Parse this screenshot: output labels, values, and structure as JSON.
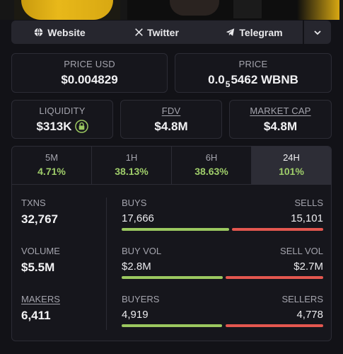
{
  "links": {
    "website": "Website",
    "twitter": "Twitter",
    "telegram": "Telegram"
  },
  "price_usd": {
    "label": "PRICE USD",
    "value": "$0.004829"
  },
  "price_native": {
    "label": "PRICE",
    "prefix": "0.0",
    "subscript": "5",
    "rest": "5462 WBNB"
  },
  "liquidity": {
    "label": "LIQUIDITY",
    "value": "$313K"
  },
  "fdv": {
    "label": "FDV",
    "value": "$4.8M"
  },
  "market_cap": {
    "label": "MARKET CAP",
    "value": "$4.8M"
  },
  "tabs": [
    {
      "label": "5M",
      "value": "4.71%"
    },
    {
      "label": "1H",
      "value": "38.13%"
    },
    {
      "label": "6H",
      "value": "38.63%"
    },
    {
      "label": "24H",
      "value": "101%"
    }
  ],
  "active_tab": "24H",
  "metrics": {
    "txns": {
      "label": "TXNS",
      "value": "32,767"
    },
    "volume": {
      "label": "VOLUME",
      "value": "$5.5M"
    },
    "makers": {
      "label": "MAKERS",
      "value": "6,411"
    }
  },
  "splits": {
    "buys_sells": {
      "left_label": "BUYS",
      "right_label": "SELLS",
      "left_value": "17,666",
      "right_value": "15,101",
      "buy_fraction": 0.539
    },
    "vol": {
      "left_label": "BUY VOL",
      "right_label": "SELL VOL",
      "left_value": "$2.8M",
      "right_value": "$2.7M",
      "buy_fraction": 0.509
    },
    "buyers_sellers": {
      "left_label": "BUYERS",
      "right_label": "SELLERS",
      "left_value": "4,919",
      "right_value": "4,778",
      "buy_fraction": 0.507
    }
  },
  "colors": {
    "positive": "#9fcd6a",
    "buy_bar": "#9bc860",
    "sell_bar": "#e4574f",
    "background": "#121217"
  }
}
